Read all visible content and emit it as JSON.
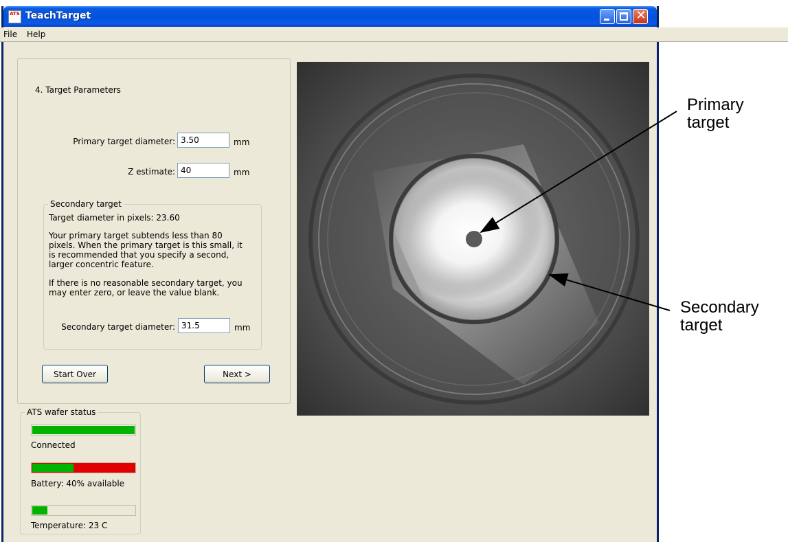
{
  "window": {
    "title": "TeachTarget",
    "icon_label": "ATS"
  },
  "menu": {
    "items": [
      "File",
      "Help"
    ]
  },
  "wizard": {
    "step_title": "4. Target Parameters",
    "primary_label": "Primary target diameter:",
    "primary_value": "3.50",
    "primary_unit": "mm",
    "z_label": "Z estimate:",
    "z_value": "40",
    "z_unit": "mm",
    "secondary": {
      "legend": "Secondary target",
      "pixels_text": "Target diameter in pixels: 23.60",
      "para1": "Your primary target subtends less than 80 pixels. When the primary target is this small, it is recommended that you specify a second, larger concentric feature.",
      "para2": "If there is no reasonable secondary target, you may enter zero, or leave the value blank.",
      "diameter_label": "Secondary target diameter:",
      "diameter_value": "31.5",
      "diameter_unit": "mm"
    },
    "start_over": "Start Over",
    "next": "Next >"
  },
  "status": {
    "legend": "ATS wafer status",
    "connection": {
      "label": "Connected",
      "level": 1.0
    },
    "battery": {
      "label": "Battery: 40% available",
      "level": 0.4
    },
    "temperature": {
      "label": "Temperature: 23 C",
      "level": 0.15
    },
    "colors": {
      "ok": "#00b300",
      "bad": "#e00000"
    }
  },
  "annotations": {
    "primary_line1": "Primary",
    "primary_line2": "target",
    "secondary_line1": "Secondary",
    "secondary_line2": "target"
  }
}
